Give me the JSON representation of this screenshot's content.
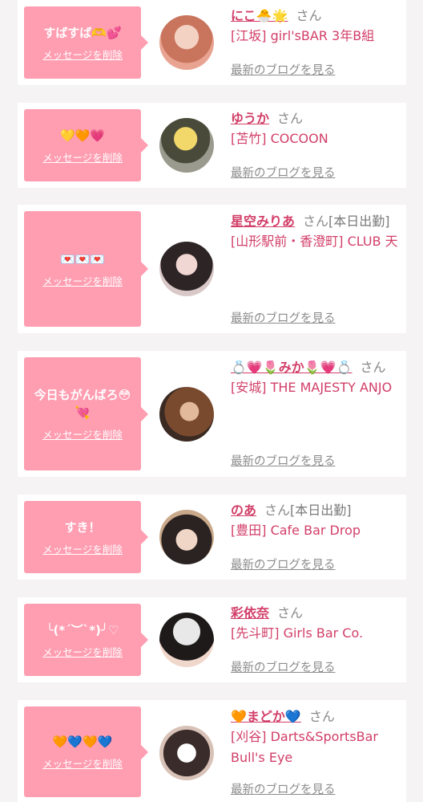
{
  "delete_label": "メッセージを削除",
  "blog_label": "最新のブログを見る",
  "colors": {
    "accent": "#d23e68",
    "bubble": "#ff9db1"
  },
  "cards": [
    {
      "message": "すばすば🫶💕",
      "name": "にこ🐣🌟",
      "honorific": "さん",
      "status": "",
      "shop": "[江坂] girl'sBAR 3年B組"
    },
    {
      "message": "💛🧡💗",
      "name": "ゆうか",
      "honorific": "さん",
      "status": "",
      "shop": "[苫竹] COCOON"
    },
    {
      "message": "💌💌💌",
      "name": "星空みりあ",
      "honorific": "さん",
      "status": "[本日出勤]",
      "shop": "[山形駅前・香澄町] CLUB 天"
    },
    {
      "message": "今日もがんばろ😳💘",
      "name": "💍💗🌷みか🌷💗💍",
      "honorific": "さん",
      "status": "",
      "shop": "[安城] THE MAJESTY ANJO"
    },
    {
      "message": "すき！",
      "name": "のあ",
      "honorific": "さん",
      "status": "[本日出勤]",
      "shop": "[豊田] Cafe Bar Drop"
    },
    {
      "message": "╰(*´︶`*)╯♡",
      "name": "彩依奈",
      "honorific": "さん",
      "status": "",
      "shop": "[先斗町] Girls Bar Co."
    },
    {
      "message": "🧡💙🧡💙",
      "name": "🧡まどか💙",
      "honorific": "さん",
      "status": "",
      "shop": "[刈谷] Darts&SportsBar Bull's Eye"
    }
  ]
}
